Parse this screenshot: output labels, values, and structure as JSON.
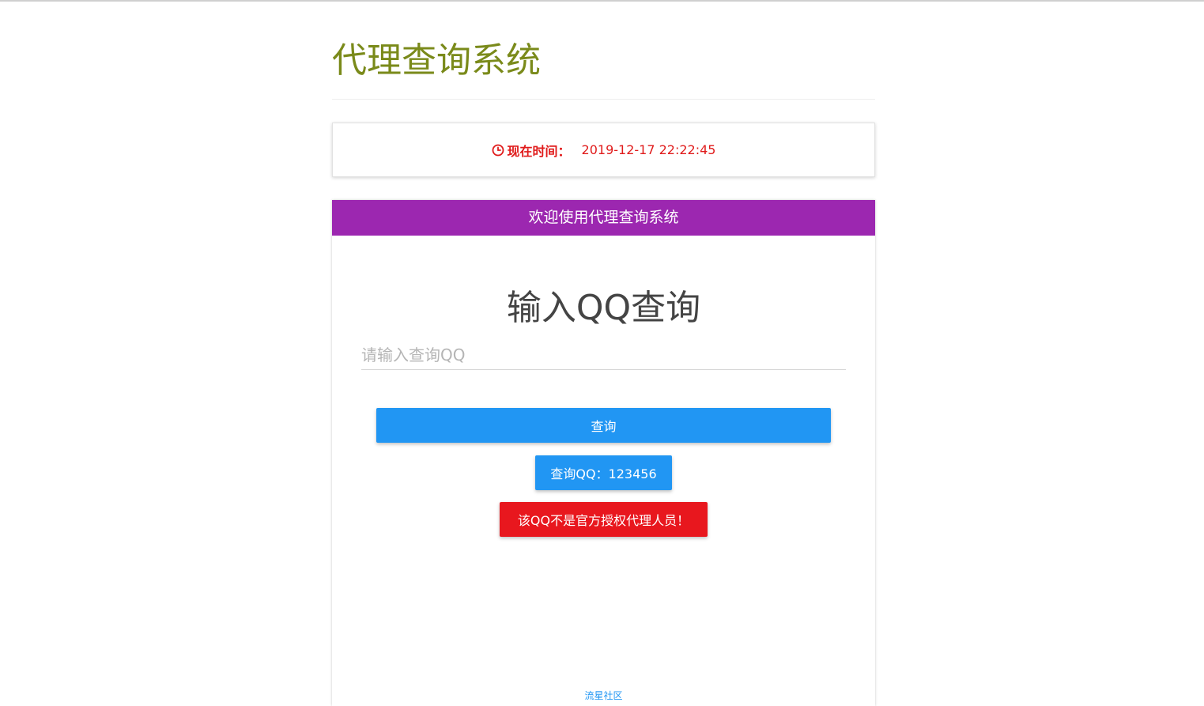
{
  "header": {
    "title": "代理查询系统"
  },
  "time_card": {
    "label": "现在时间：",
    "value": "2019-12-17 22:22:45",
    "icon": "clock-icon",
    "color": "#e01b1b"
  },
  "main_card": {
    "header_title": "欢迎使用代理查询系统",
    "header_color": "#9c27b0",
    "heading": "输入QQ查询",
    "input": {
      "value": "",
      "placeholder": "请输入查询QQ"
    },
    "query_button_label": "查询",
    "result_label": "查询QQ：123456",
    "warning_label": "该QQ不是官方授权代理人员！",
    "primary_color": "#2196f3",
    "danger_color": "#e8171e"
  },
  "footer": {
    "link_text": "流星社区"
  }
}
